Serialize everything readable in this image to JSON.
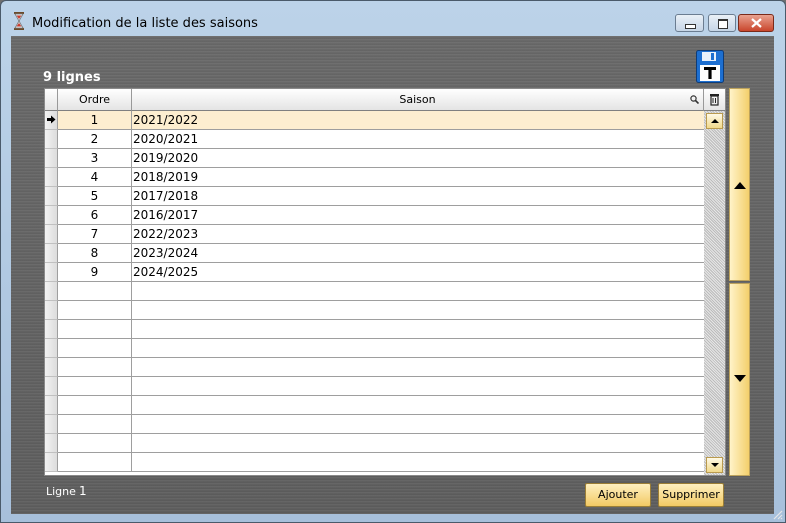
{
  "window": {
    "title": "Modification de la liste des saisons",
    "icons": {
      "app": "hourglass-icon",
      "minimize": "minimize-icon",
      "maximize": "maximize-icon",
      "close": "close-icon"
    }
  },
  "list": {
    "count_label": "9 lignes",
    "columns": {
      "ordre": "Ordre",
      "saison": "Saison"
    },
    "rows": [
      {
        "ordre": "1",
        "saison": "2021/2022"
      },
      {
        "ordre": "2",
        "saison": "2020/2021"
      },
      {
        "ordre": "3",
        "saison": "2019/2020"
      },
      {
        "ordre": "4",
        "saison": "2018/2019"
      },
      {
        "ordre": "5",
        "saison": "2017/2018"
      },
      {
        "ordre": "6",
        "saison": "2016/2017"
      },
      {
        "ordre": "7",
        "saison": "2022/2023"
      },
      {
        "ordre": "8",
        "saison": "2023/2024"
      },
      {
        "ordre": "9",
        "saison": "2024/2025"
      }
    ],
    "empty_row_count": 10,
    "current_row_index": 0
  },
  "footer": {
    "ligne_label": "Ligne",
    "ligne_value": "1",
    "add_button": "Ajouter",
    "delete_button": "Supprimer"
  },
  "colors": {
    "selected_row": "#fdeed0",
    "button_accent": "#f2c964"
  }
}
